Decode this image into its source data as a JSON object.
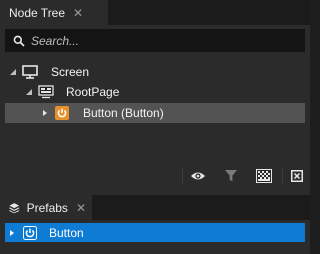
{
  "node_tree": {
    "tab_title": "Node Tree",
    "close_glyph": "✕",
    "search_placeholder": "Search...",
    "nodes": [
      {
        "label": "Screen",
        "icon": "monitor-icon",
        "expanded": true
      },
      {
        "label": "RootPage",
        "icon": "page-icon",
        "expanded": true
      },
      {
        "label": "Button (Button)",
        "icon": "power-button-icon",
        "expanded": false,
        "selected": true
      }
    ],
    "toolbar": [
      "eye-icon",
      "filter-icon",
      "checkerboard-icon",
      "collapse-icon"
    ]
  },
  "prefabs": {
    "tab_title": "Prefabs",
    "close_glyph": "✕",
    "items": [
      {
        "label": "Button",
        "icon": "power-button-icon",
        "selected": true
      }
    ]
  },
  "colors": {
    "accent": "#0e7bd4",
    "node_icon_orange": "#e8912c",
    "selected_row": "#535353"
  }
}
